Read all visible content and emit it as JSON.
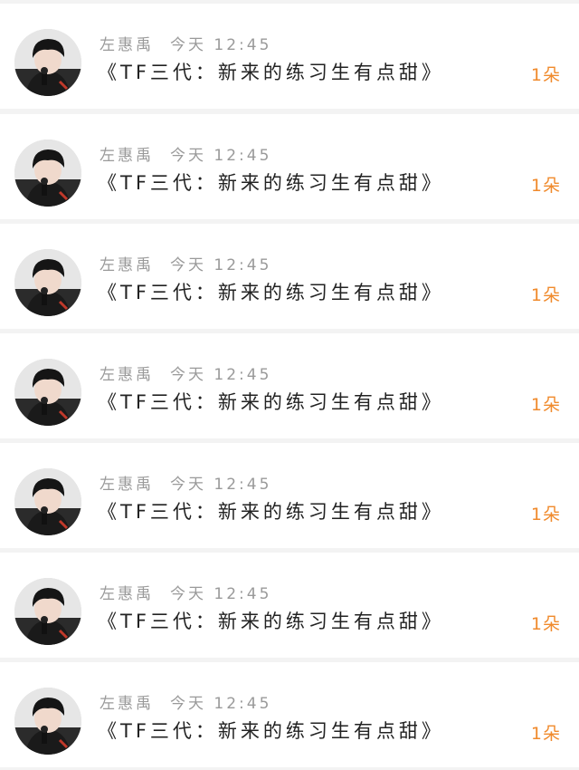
{
  "colors": {
    "background": "#f3f3f3",
    "card": "#ffffff",
    "meta_text": "#9a9a9a",
    "message_text": "#222222",
    "accent": "#f08a2c"
  },
  "notifications": [
    {
      "sender": "左惠禹",
      "time": "今天 12:45",
      "message": "《TF三代：新来的练习生有点甜》",
      "gift": "1朵"
    },
    {
      "sender": "左惠禹",
      "time": "今天 12:45",
      "message": "《TF三代：新来的练习生有点甜》",
      "gift": "1朵"
    },
    {
      "sender": "左惠禹",
      "time": "今天 12:45",
      "message": "《TF三代：新来的练习生有点甜》",
      "gift": "1朵"
    },
    {
      "sender": "左惠禹",
      "time": "今天 12:45",
      "message": "《TF三代：新来的练习生有点甜》",
      "gift": "1朵"
    },
    {
      "sender": "左惠禹",
      "time": "今天 12:45",
      "message": "《TF三代：新来的练习生有点甜》",
      "gift": "1朵"
    },
    {
      "sender": "左惠禹",
      "time": "今天 12:45",
      "message": "《TF三代：新来的练习生有点甜》",
      "gift": "1朵"
    },
    {
      "sender": "左惠禹",
      "time": "今天 12:45",
      "message": "《TF三代：新来的练习生有点甜》",
      "gift": "1朵"
    }
  ]
}
